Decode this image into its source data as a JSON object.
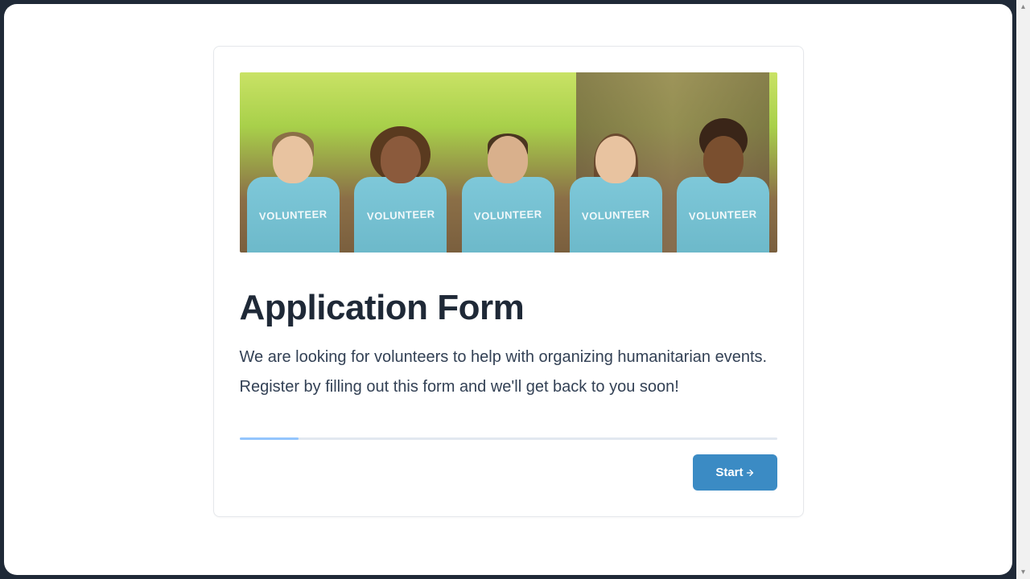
{
  "hero": {
    "shirt_text": "VOLUNTEER"
  },
  "heading": "Application Form",
  "description": "We are looking for volunteers to help with organizing humanitarian events. Register by filling out this form and we'll get back to you soon!",
  "button": {
    "start_label": "Start"
  },
  "progress": {
    "percent": 11
  }
}
